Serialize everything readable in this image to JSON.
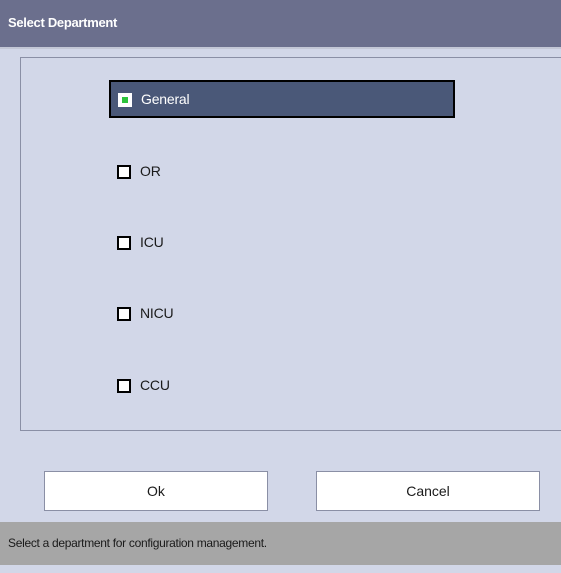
{
  "dialog": {
    "title": "Select Department"
  },
  "departments": [
    {
      "label": "General",
      "selected": true
    },
    {
      "label": "OR",
      "selected": false
    },
    {
      "label": "ICU",
      "selected": false
    },
    {
      "label": "NICU",
      "selected": false
    },
    {
      "label": "CCU",
      "selected": false
    }
  ],
  "buttons": {
    "ok_label": "Ok",
    "cancel_label": "Cancel"
  },
  "status": {
    "message": "Select a department for configuration management."
  },
  "colors": {
    "titlebar": "#6b6f8d",
    "panel": "#d2d7e8",
    "selected_row": "#4a5878",
    "checked_indicator": "#2ec43d",
    "statusbar": "#a6a6a6"
  }
}
